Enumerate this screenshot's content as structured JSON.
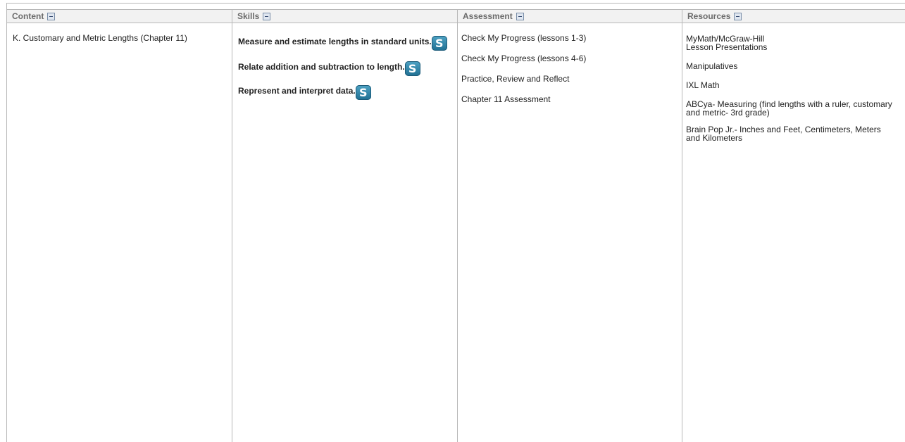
{
  "headers": {
    "content": "Content",
    "skills": "Skills",
    "assessment": "Assessment",
    "resources": "Resources"
  },
  "content": {
    "text": "K. Customary and Metric Lengths (Chapter 11)"
  },
  "skills": {
    "items": [
      {
        "label": "Measure and estimate lengths in standard units.",
        "icon": "standards-s-icon"
      },
      {
        "label": "Relate addition and subtraction to length.",
        "icon": "standards-s-icon"
      },
      {
        "label": "Represent and interpret data.",
        "icon": "standards-s-icon"
      }
    ],
    "icon_glyph": "S"
  },
  "assessment": {
    "items": [
      "Check My Progress (lessons 1-3)",
      "Check My Progress (lessons 4-6)",
      "Practice, Review and Reflect",
      "Chapter 11 Assessment"
    ]
  },
  "resources": {
    "items": [
      "MyMath/McGraw-Hill",
      "Lesson Presentations",
      "Manipulatives",
      "IXL Math",
      "ABCya- Measuring (find lengths with a ruler, customary and metric- 3rd grade)",
      "Brain Pop Jr.- Inches and Feet, Centimeters, Meters and Kilometers"
    ]
  },
  "colors": {
    "header_bg": "#f2f2f2",
    "header_text": "#6b6b6b",
    "border": "#b8b8b8",
    "icon_accent": "#1f6f92"
  }
}
